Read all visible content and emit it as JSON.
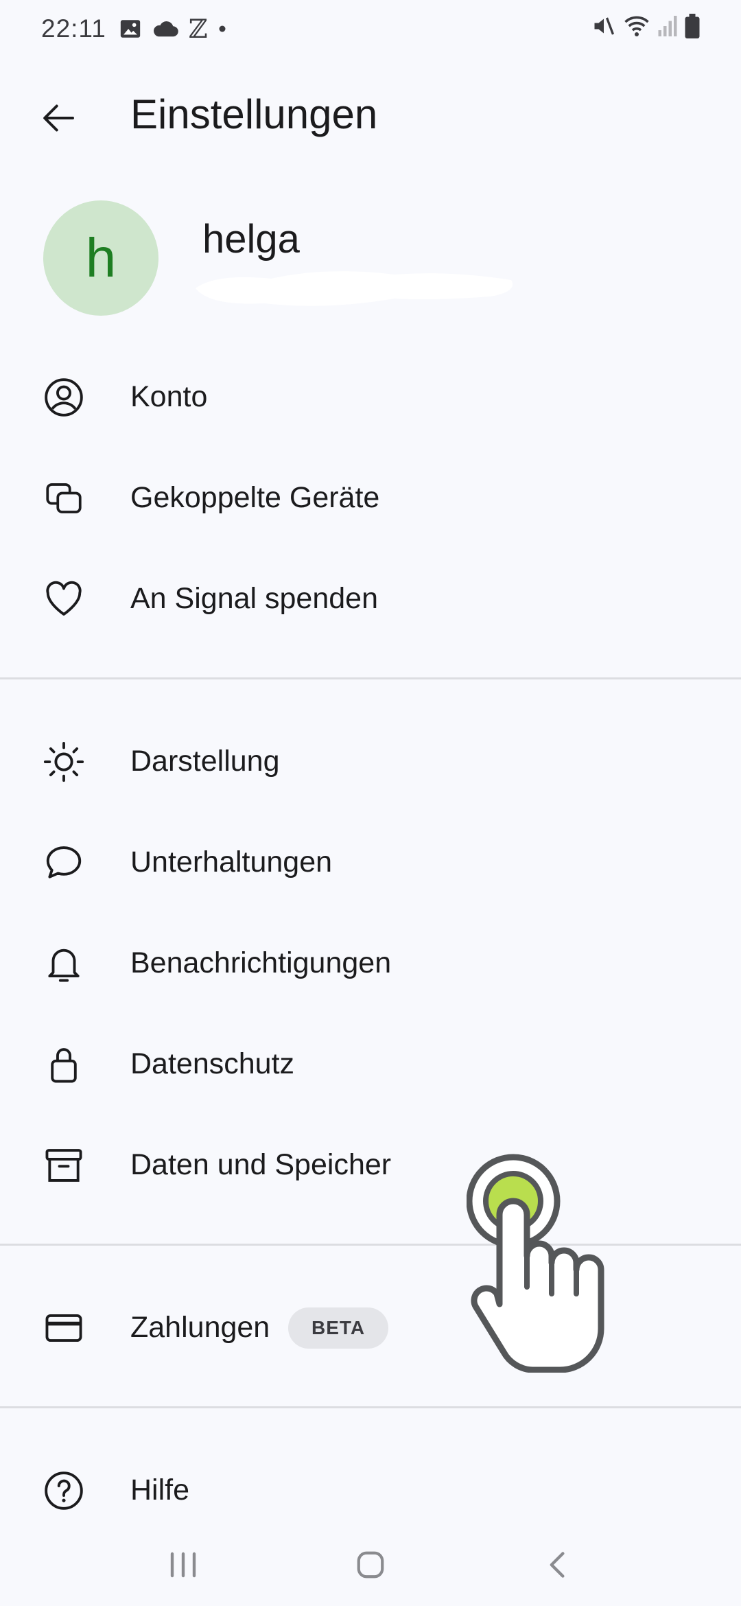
{
  "status_bar": {
    "time": "22:11",
    "icons_left": [
      "image-icon",
      "cloud-icon",
      "z-icon",
      "dot-icon"
    ],
    "icons_right": [
      "mute-icon",
      "wifi-icon",
      "signal-icon",
      "battery-icon"
    ]
  },
  "app_bar": {
    "title": "Einstellungen",
    "back_icon": "arrow-back-icon"
  },
  "profile": {
    "avatar_letter": "h",
    "name": "helga",
    "avatar_bg": "#cfe6cd",
    "avatar_fg": "#1e7e22"
  },
  "menu": {
    "konto": "Konto",
    "linked_devices": "Gekoppelte Geräte",
    "donate": "An Signal spenden",
    "appearance": "Darstellung",
    "chats": "Unterhaltungen",
    "notifications": "Benachrichtigungen",
    "privacy": "Datenschutz",
    "data_storage": "Daten und Speicher",
    "payments": "Zahlungen",
    "payments_badge": "BETA",
    "help": "Hilfe"
  },
  "colors": {
    "background": "#f8f9fd",
    "divider": "#dcdde1",
    "tap_accent": "#b9de4e"
  }
}
